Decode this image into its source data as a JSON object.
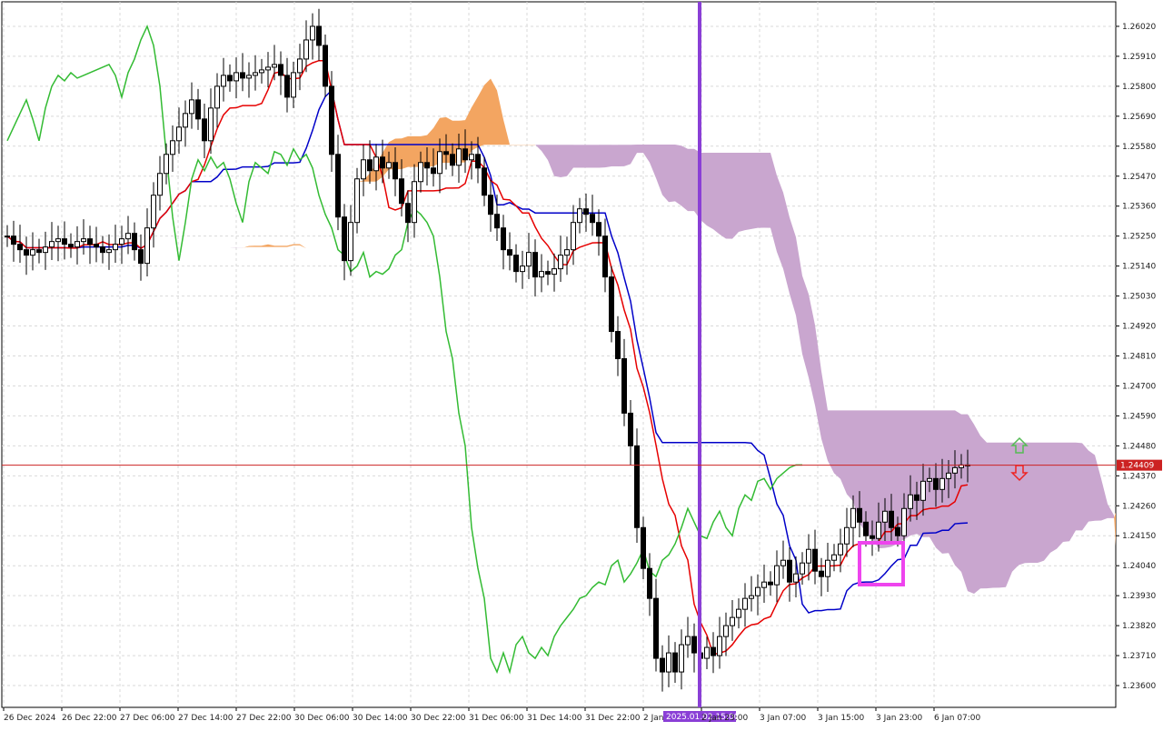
{
  "colors": {
    "background": "#ffffff",
    "grid": "#d9d9d9",
    "candle_up": "#ffffff",
    "candle_down": "#000000",
    "wick": "#000000",
    "tenkan": "#e60000",
    "kijun": "#0000c8",
    "chikou": "#33bb33",
    "cloud_bearish": "#c9a6cf",
    "cloud_bullish": "#f3a561",
    "vertical_marker": "#8a3fd6",
    "highlight_box": "#ee44ee",
    "bid_line": "#cc2222",
    "arrow_up": "#55bb55",
    "arrow_down": "#ee2222"
  },
  "chart_data": {
    "type": "candlestick",
    "instrument_note": "",
    "ylim": [
      1.2352,
      1.2611
    ],
    "y_ticks": [
      "1.26020",
      "1.25910",
      "1.25800",
      "1.25690",
      "1.25580",
      "1.25470",
      "1.25360",
      "1.25250",
      "1.25140",
      "1.25030",
      "1.24920",
      "1.24810",
      "1.24700",
      "1.24590",
      "1.24480",
      "1.24370",
      "1.24260",
      "1.24150",
      "1.24040",
      "1.23930",
      "1.23820",
      "1.23710",
      "1.23600"
    ],
    "x_ticks": [
      "26 Dec 2024",
      "26 Dec 22:00",
      "27 Dec 06:00",
      "27 Dec 14:00",
      "27 Dec 22:00",
      "30 Dec 06:00",
      "30 Dec 14:00",
      "30 Dec 22:00",
      "31 Dec 06:00",
      "31 Dec 14:00",
      "31 Dec 22:00",
      "2 Jan",
      "2 Jan 23:00",
      "3 Jan 07:00",
      "3 Jan 15:00",
      "3 Jan 23:00",
      "6 Jan 07:00"
    ],
    "current_price": "1.24409",
    "marker_time_label": "2025.01.02 15:00",
    "bar_count": 152,
    "close": [
      1.2525,
      1.2522,
      1.252,
      1.2518,
      1.252,
      1.2519,
      1.2521,
      1.2523,
      1.2524,
      1.2522,
      1.2521,
      1.2523,
      1.2524,
      1.2522,
      1.2521,
      1.2519,
      1.252,
      1.2522,
      1.2524,
      1.2526,
      1.252,
      1.2515,
      1.2528,
      1.254,
      1.2548,
      1.2555,
      1.256,
      1.2565,
      1.257,
      1.2575,
      1.2568,
      1.256,
      1.2572,
      1.258,
      1.2584,
      1.2582,
      1.2585,
      1.2583,
      1.2584,
      1.2585,
      1.2586,
      1.2587,
      1.2588,
      1.2584,
      1.2576,
      1.2585,
      1.259,
      1.2597,
      1.2602,
      1.2595,
      1.258,
      1.2555,
      1.2532,
      1.2516,
      1.253,
      1.2546,
      1.2553,
      1.2549,
      1.2554,
      1.255,
      1.2552,
      1.2546,
      1.2537,
      1.253,
      1.2545,
      1.2552,
      1.255,
      1.2548,
      1.2556,
      1.2555,
      1.2551,
      1.2557,
      1.2553,
      1.2555,
      1.255,
      1.254,
      1.2533,
      1.2528,
      1.252,
      1.2518,
      1.2512,
      1.2514,
      1.2519,
      1.251,
      1.2512,
      1.2511,
      1.2513,
      1.2518,
      1.252,
      1.253,
      1.2535,
      1.2533,
      1.253,
      1.2525,
      1.251,
      1.249,
      1.248,
      1.246,
      1.2448,
      1.2418,
      1.2403,
      1.2392,
      1.237,
      1.2365,
      1.2372,
      1.2365,
      1.2375,
      1.2378,
      1.2372,
      1.237,
      1.2374,
      1.2371,
      1.2378,
      1.2382,
      1.2385,
      1.2388,
      1.2392,
      1.2393,
      1.2396,
      1.2398,
      1.2397,
      1.2404,
      1.2406,
      1.2398,
      1.2401,
      1.2405,
      1.241,
      1.2402,
      1.24,
      1.2406,
      1.2408,
      1.2412,
      1.2418,
      1.2425,
      1.242,
      1.2415,
      1.2414,
      1.242,
      1.2424,
      1.2418,
      1.2415,
      1.2425,
      1.243,
      1.2428,
      1.2435,
      1.2436,
      1.2432,
      1.2436,
      1.2438,
      1.244,
      1.2441,
      1.2441
    ]
  },
  "axis": {
    "price_tag": "1.24409",
    "time_tag": "2025.01.02 15:00"
  }
}
